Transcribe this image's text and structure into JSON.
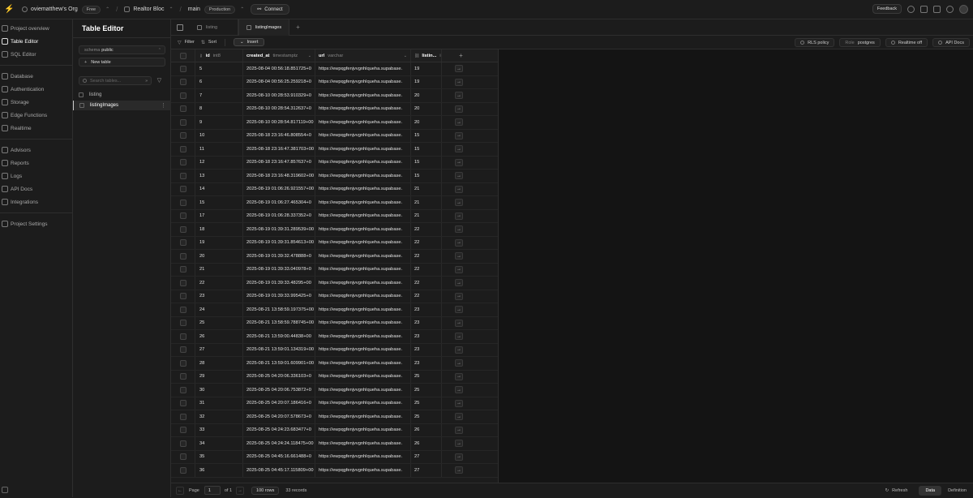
{
  "topbar": {
    "org": "oviematthew's Org",
    "org_plan": "Free",
    "project": "Realtor Bloc",
    "branch": "main",
    "branch_env": "Production",
    "connect": "Connect",
    "feedback": "Feedback"
  },
  "nav": {
    "items": [
      "Project overview",
      "Table Editor",
      "SQL Editor",
      "Database",
      "Authentication",
      "Storage",
      "Edge Functions",
      "Realtime",
      "Advisors",
      "Reports",
      "Logs",
      "API Docs",
      "Integrations",
      "Project Settings"
    ]
  },
  "sidebar": {
    "title": "Table Editor",
    "schema_label": "schema",
    "schema_value": "public",
    "new_table": "New table",
    "search_placeholder": "Search tables...",
    "tables": [
      "listing",
      "listingImages"
    ]
  },
  "tabs": [
    "listing",
    "listingImages"
  ],
  "toolbar": {
    "filter": "Filter",
    "sort": "Sort",
    "insert": "Insert",
    "rls": "RLS policy",
    "role_label": "Role",
    "role_value": "postgres",
    "realtime": "Realtime off",
    "api_docs": "API Docs"
  },
  "columns": {
    "id": {
      "name": "id",
      "type": "int8"
    },
    "created_at": {
      "name": "created_at",
      "type": "timestamptz"
    },
    "url": {
      "name": "url",
      "type": "varchar"
    },
    "listing": {
      "name": "listin...",
      "type": "i..."
    }
  },
  "rows": [
    {
      "id": "5",
      "created_at": "2025-08-04 00:56:18.851725+0",
      "url": "https://ewpqgfenjvvgnhlqueha.supabase.",
      "listing": "19"
    },
    {
      "id": "6",
      "created_at": "2025-08-04 00:56:25.259218+0",
      "url": "https://ewpqgfenjvvgnhlqueha.supabase.",
      "listing": "19"
    },
    {
      "id": "7",
      "created_at": "2025-08-10 00:28:53.910329+0",
      "url": "https://ewpqgfenjvvgnhlqueha.supabase.",
      "listing": "20"
    },
    {
      "id": "8",
      "created_at": "2025-08-10 00:28:54.312637+0",
      "url": "https://ewpqgfenjvvgnhlqueha.supabase.",
      "listing": "20"
    },
    {
      "id": "9",
      "created_at": "2025-08-10 00:28:54.817119+00",
      "url": "https://ewpqgfenjvvgnhlqueha.supabase.",
      "listing": "20"
    },
    {
      "id": "10",
      "created_at": "2025-08-18 23:16:46.808554+0",
      "url": "https://ewpqgfenjvvgnhlqueha.supabase.",
      "listing": "15"
    },
    {
      "id": "11",
      "created_at": "2025-08-18 23:16:47.381703+00",
      "url": "https://ewpqgfenjvvgnhlqueha.supabase.",
      "listing": "15"
    },
    {
      "id": "12",
      "created_at": "2025-08-18 23:16:47.857637+0",
      "url": "https://ewpqgfenjvvgnhlqueha.supabase.",
      "listing": "15"
    },
    {
      "id": "13",
      "created_at": "2025-08-18 23:16:48.319602+00",
      "url": "https://ewpqgfenjvvgnhlqueha.supabase.",
      "listing": "15"
    },
    {
      "id": "14",
      "created_at": "2025-08-19 01:06:26.921557+00",
      "url": "https://ewpqgfenjvvgnhlqueha.supabase.",
      "listing": "21"
    },
    {
      "id": "15",
      "created_at": "2025-08-19 01:06:27.465304+0",
      "url": "https://ewpqgfenjvvgnhlqueha.supabase.",
      "listing": "21"
    },
    {
      "id": "17",
      "created_at": "2025-08-19 01:06:28.337352+0",
      "url": "https://ewpqgfenjvvgnhlqueha.supabase.",
      "listing": "21"
    },
    {
      "id": "18",
      "created_at": "2025-08-19 01:39:31.289539+00",
      "url": "https://ewpqgfenjvvgnhlqueha.supabase.",
      "listing": "22"
    },
    {
      "id": "19",
      "created_at": "2025-08-19 01:39:31.854613+00",
      "url": "https://ewpqgfenjvvgnhlqueha.supabase.",
      "listing": "22"
    },
    {
      "id": "20",
      "created_at": "2025-08-19 01:39:32.478888+0",
      "url": "https://ewpqgfenjvvgnhlqueha.supabase.",
      "listing": "22"
    },
    {
      "id": "21",
      "created_at": "2025-08-19 01:39:33.040978+0",
      "url": "https://ewpqgfenjvvgnhlqueha.supabase.",
      "listing": "22"
    },
    {
      "id": "22",
      "created_at": "2025-08-19 01:39:33.48295+00",
      "url": "https://ewpqgfenjvvgnhlqueha.supabase.",
      "listing": "22"
    },
    {
      "id": "23",
      "created_at": "2025-08-19 01:39:33.995425+0",
      "url": "https://ewpqgfenjvvgnhlqueha.supabase.",
      "listing": "22"
    },
    {
      "id": "24",
      "created_at": "2025-08-21 13:58:59.197375+00",
      "url": "https://ewpqgfenjvvgnhlqueha.supabase.",
      "listing": "23"
    },
    {
      "id": "25",
      "created_at": "2025-08-21 13:58:59.788745+00",
      "url": "https://ewpqgfenjvvgnhlqueha.supabase.",
      "listing": "23"
    },
    {
      "id": "26",
      "created_at": "2025-08-21 13:59:00.44838+00",
      "url": "https://ewpqgfenjvvgnhlqueha.supabase.",
      "listing": "23"
    },
    {
      "id": "27",
      "created_at": "2025-08-21 13:59:01.134319+00",
      "url": "https://ewpqgfenjvvgnhlqueha.supabase.",
      "listing": "23"
    },
    {
      "id": "28",
      "created_at": "2025-08-21 13:59:01.609901+00",
      "url": "https://ewpqgfenjvvgnhlqueha.supabase.",
      "listing": "23"
    },
    {
      "id": "29",
      "created_at": "2025-08-25 04:20:06.336103+0",
      "url": "https://ewpqgfenjvvgnhlqueha.supabase.",
      "listing": "25"
    },
    {
      "id": "30",
      "created_at": "2025-08-25 04:20:06.753872+0",
      "url": "https://ewpqgfenjvvgnhlqueha.supabase.",
      "listing": "25"
    },
    {
      "id": "31",
      "created_at": "2025-08-25 04:20:07.186416+0",
      "url": "https://ewpqgfenjvvgnhlqueha.supabase.",
      "listing": "25"
    },
    {
      "id": "32",
      "created_at": "2025-08-25 04:20:07.578673+0",
      "url": "https://ewpqgfenjvvgnhlqueha.supabase.",
      "listing": "25"
    },
    {
      "id": "33",
      "created_at": "2025-08-25 04:24:23.683477+0",
      "url": "https://ewpqgfenjvvgnhlqueha.supabase.",
      "listing": "26"
    },
    {
      "id": "34",
      "created_at": "2025-08-25 04:24:24.118475+00",
      "url": "https://ewpqgfenjvvgnhlqueha.supabase.",
      "listing": "26"
    },
    {
      "id": "35",
      "created_at": "2025-08-25 04:45:16.661488+0",
      "url": "https://ewpqgfenjvvgnhlqueha.supabase.",
      "listing": "27"
    },
    {
      "id": "36",
      "created_at": "2025-08-25 04:45:17.115809+00",
      "url": "https://ewpqgfenjvvgnhlqueha.supabase.",
      "listing": "27"
    }
  ],
  "footer": {
    "page_label": "Page",
    "page_value": "1",
    "of_label": "of 1",
    "rows_select": "100 rows",
    "records": "33 records",
    "refresh": "Refresh",
    "data_tab": "Data",
    "definition_tab": "Definition"
  }
}
